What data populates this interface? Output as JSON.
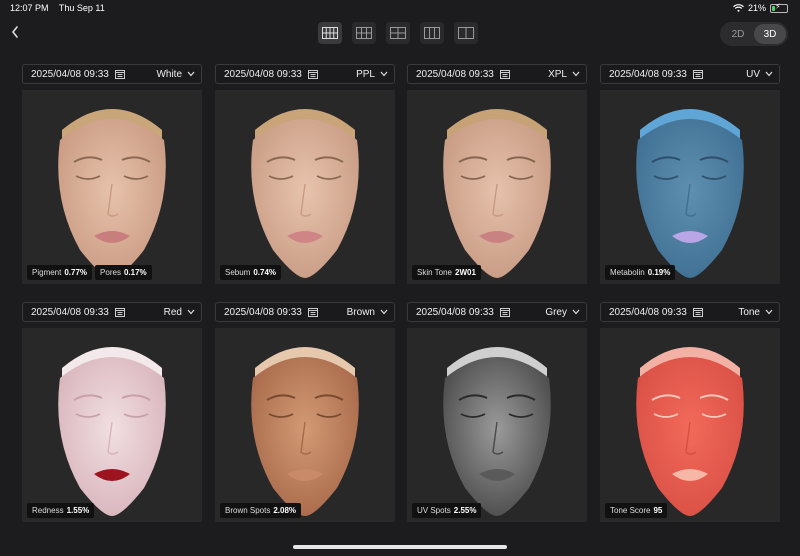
{
  "status_bar": {
    "time": "12:07 PM",
    "date": "Thu Sep 11",
    "battery": "21%",
    "battery_level": 0.21
  },
  "toolbar": {
    "layouts": [
      {
        "name": "layout-4x2-icon",
        "active": true
      },
      {
        "name": "layout-3x2-icon",
        "active": false
      },
      {
        "name": "layout-2x2-icon",
        "active": false
      },
      {
        "name": "layout-3col-icon",
        "active": false
      },
      {
        "name": "layout-2col-icon",
        "active": false
      }
    ],
    "toggle": {
      "opt_2d": "2D",
      "opt_3d": "3D",
      "active": "3D"
    }
  },
  "panels": [
    {
      "date": "2025/04/08 09:33",
      "mode": "White",
      "metrics": [
        {
          "label": "Pigment",
          "value": "0.77%"
        },
        {
          "label": "Pores",
          "value": "0.17%"
        }
      ]
    },
    {
      "date": "2025/04/08 09:33",
      "mode": "PPL",
      "metrics": [
        {
          "label": "Sebum",
          "value": "0.74%"
        }
      ]
    },
    {
      "date": "2025/04/08 09:33",
      "mode": "XPL",
      "metrics": [
        {
          "label": "Skin Tone",
          "value": "2W01"
        }
      ]
    },
    {
      "date": "2025/04/08 09:33",
      "mode": "UV",
      "metrics": [
        {
          "label": "Metabolin",
          "value": "0.19%"
        }
      ]
    },
    {
      "date": "2025/04/08 09:33",
      "mode": "Red",
      "metrics": [
        {
          "label": "Redness",
          "value": "1.55%"
        }
      ]
    },
    {
      "date": "2025/04/08 09:33",
      "mode": "Brown",
      "metrics": [
        {
          "label": "Brown Spots",
          "value": "2.08%"
        }
      ]
    },
    {
      "date": "2025/04/08 09:33",
      "mode": "Grey",
      "metrics": [
        {
          "label": "UV Spots",
          "value": "2.55%"
        }
      ]
    },
    {
      "date": "2025/04/08 09:33",
      "mode": "Tone",
      "metrics": [
        {
          "label": "Tone Score",
          "value": "95"
        }
      ]
    }
  ],
  "face_styles": [
    {
      "skin": "#e7c2ab",
      "shade": "#c99a82",
      "hair": "#c9a57a",
      "lips": "#c97e7e",
      "brow": "#8a6a52"
    },
    {
      "skin": "#e8c4ad",
      "shade": "#c89b84",
      "hair": "#c8a478",
      "lips": "#cf8585",
      "brow": "#8a6a52"
    },
    {
      "skin": "#e6c1ab",
      "shade": "#c79a83",
      "hair": "#c6a276",
      "lips": "#c98282",
      "brow": "#86664f"
    },
    {
      "skin": "#5f8fb0",
      "shade": "#3f6f92",
      "hair": "#5fa6d6",
      "lips": "#b9a6e6",
      "brow": "#2f4f6a"
    },
    {
      "skin": "#f1dfe2",
      "shade": "#d8b4bb",
      "hair": "#f3e8ea",
      "lips": "#9d1420",
      "brow": "#c7a0a8"
    },
    {
      "skin": "#d29a74",
      "shade": "#a8694a",
      "hair": "#e6c8ad",
      "lips": "#c98a6a",
      "brow": "#7a4a30"
    },
    {
      "skin": "#9a9a9a",
      "shade": "#4a4a4a",
      "hair": "#cfcfcf",
      "lips": "#5a5a5a",
      "brow": "#2a2a2a"
    },
    {
      "skin": "#f26a5a",
      "shade": "#d94f45",
      "hair": "#f3b0a4",
      "lips": "#f6b7a6",
      "brow": "#f7c8bb"
    }
  ]
}
